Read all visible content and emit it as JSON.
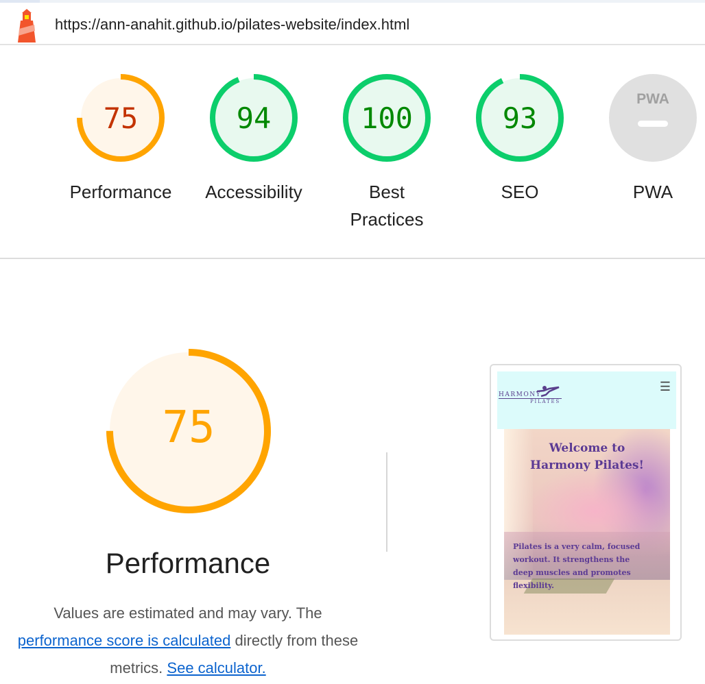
{
  "url": "https://ann-anahit.github.io/pilates-website/index.html",
  "icons": {
    "logo": "lighthouse-icon",
    "pwa": "pwa-icon"
  },
  "colors": {
    "orange": "#ffa400",
    "orange_text": "#c33300",
    "orange_bg": "#fff6ea",
    "green": "#0cce6b",
    "green_text": "#008800",
    "green_bg": "#e8f9ef",
    "grey": "#e0e0e0"
  },
  "gauges": [
    {
      "score": "75",
      "label": "Performance",
      "fraction": 0.75,
      "status": "average"
    },
    {
      "score": "94",
      "label": "Accessibility",
      "fraction": 0.94,
      "status": "pass"
    },
    {
      "score": "100",
      "label": "Best Practices",
      "fraction": 1.0,
      "status": "pass"
    },
    {
      "score": "93",
      "label": "SEO",
      "fraction": 0.93,
      "status": "pass"
    },
    {
      "score": "",
      "label": "PWA",
      "badge": "PWA",
      "status": "na"
    }
  ],
  "performance": {
    "score": "75",
    "fraction": 0.75,
    "title": "Performance",
    "desc_prefix": "Values are estimated and may vary. The",
    "link1": "performance score is calculated",
    "desc_middle": "directly from these metrics.",
    "link2": "See calculator."
  },
  "screenshot": {
    "brand_top": "HARMONY",
    "brand_bottom": "PILATES",
    "menu_icon": "hamburger-icon",
    "menu_glyph": "☰",
    "hero_title_1": "Welcome to",
    "hero_title_2": "Harmony Pilates!",
    "hero_text": "Pilates is a very calm, focused workout. It strengthens the deep muscles and promotes flexibility."
  }
}
